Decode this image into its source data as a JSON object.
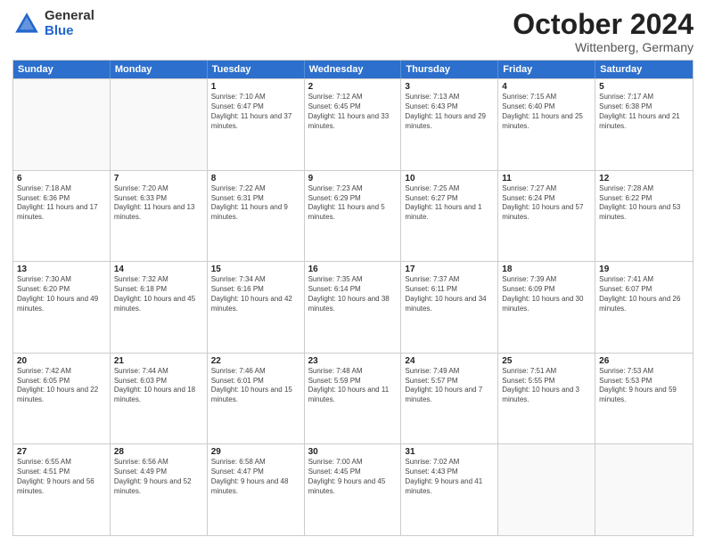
{
  "logo": {
    "general": "General",
    "blue": "Blue"
  },
  "header": {
    "month": "October 2024",
    "location": "Wittenberg, Germany"
  },
  "weekdays": [
    "Sunday",
    "Monday",
    "Tuesday",
    "Wednesday",
    "Thursday",
    "Friday",
    "Saturday"
  ],
  "weeks": [
    [
      {
        "day": "",
        "sunrise": "",
        "sunset": "",
        "daylight": ""
      },
      {
        "day": "",
        "sunrise": "",
        "sunset": "",
        "daylight": ""
      },
      {
        "day": "1",
        "sunrise": "Sunrise: 7:10 AM",
        "sunset": "Sunset: 6:47 PM",
        "daylight": "Daylight: 11 hours and 37 minutes."
      },
      {
        "day": "2",
        "sunrise": "Sunrise: 7:12 AM",
        "sunset": "Sunset: 6:45 PM",
        "daylight": "Daylight: 11 hours and 33 minutes."
      },
      {
        "day": "3",
        "sunrise": "Sunrise: 7:13 AM",
        "sunset": "Sunset: 6:43 PM",
        "daylight": "Daylight: 11 hours and 29 minutes."
      },
      {
        "day": "4",
        "sunrise": "Sunrise: 7:15 AM",
        "sunset": "Sunset: 6:40 PM",
        "daylight": "Daylight: 11 hours and 25 minutes."
      },
      {
        "day": "5",
        "sunrise": "Sunrise: 7:17 AM",
        "sunset": "Sunset: 6:38 PM",
        "daylight": "Daylight: 11 hours and 21 minutes."
      }
    ],
    [
      {
        "day": "6",
        "sunrise": "Sunrise: 7:18 AM",
        "sunset": "Sunset: 6:36 PM",
        "daylight": "Daylight: 11 hours and 17 minutes."
      },
      {
        "day": "7",
        "sunrise": "Sunrise: 7:20 AM",
        "sunset": "Sunset: 6:33 PM",
        "daylight": "Daylight: 11 hours and 13 minutes."
      },
      {
        "day": "8",
        "sunrise": "Sunrise: 7:22 AM",
        "sunset": "Sunset: 6:31 PM",
        "daylight": "Daylight: 11 hours and 9 minutes."
      },
      {
        "day": "9",
        "sunrise": "Sunrise: 7:23 AM",
        "sunset": "Sunset: 6:29 PM",
        "daylight": "Daylight: 11 hours and 5 minutes."
      },
      {
        "day": "10",
        "sunrise": "Sunrise: 7:25 AM",
        "sunset": "Sunset: 6:27 PM",
        "daylight": "Daylight: 11 hours and 1 minute."
      },
      {
        "day": "11",
        "sunrise": "Sunrise: 7:27 AM",
        "sunset": "Sunset: 6:24 PM",
        "daylight": "Daylight: 10 hours and 57 minutes."
      },
      {
        "day": "12",
        "sunrise": "Sunrise: 7:28 AM",
        "sunset": "Sunset: 6:22 PM",
        "daylight": "Daylight: 10 hours and 53 minutes."
      }
    ],
    [
      {
        "day": "13",
        "sunrise": "Sunrise: 7:30 AM",
        "sunset": "Sunset: 6:20 PM",
        "daylight": "Daylight: 10 hours and 49 minutes."
      },
      {
        "day": "14",
        "sunrise": "Sunrise: 7:32 AM",
        "sunset": "Sunset: 6:18 PM",
        "daylight": "Daylight: 10 hours and 45 minutes."
      },
      {
        "day": "15",
        "sunrise": "Sunrise: 7:34 AM",
        "sunset": "Sunset: 6:16 PM",
        "daylight": "Daylight: 10 hours and 42 minutes."
      },
      {
        "day": "16",
        "sunrise": "Sunrise: 7:35 AM",
        "sunset": "Sunset: 6:14 PM",
        "daylight": "Daylight: 10 hours and 38 minutes."
      },
      {
        "day": "17",
        "sunrise": "Sunrise: 7:37 AM",
        "sunset": "Sunset: 6:11 PM",
        "daylight": "Daylight: 10 hours and 34 minutes."
      },
      {
        "day": "18",
        "sunrise": "Sunrise: 7:39 AM",
        "sunset": "Sunset: 6:09 PM",
        "daylight": "Daylight: 10 hours and 30 minutes."
      },
      {
        "day": "19",
        "sunrise": "Sunrise: 7:41 AM",
        "sunset": "Sunset: 6:07 PM",
        "daylight": "Daylight: 10 hours and 26 minutes."
      }
    ],
    [
      {
        "day": "20",
        "sunrise": "Sunrise: 7:42 AM",
        "sunset": "Sunset: 6:05 PM",
        "daylight": "Daylight: 10 hours and 22 minutes."
      },
      {
        "day": "21",
        "sunrise": "Sunrise: 7:44 AM",
        "sunset": "Sunset: 6:03 PM",
        "daylight": "Daylight: 10 hours and 18 minutes."
      },
      {
        "day": "22",
        "sunrise": "Sunrise: 7:46 AM",
        "sunset": "Sunset: 6:01 PM",
        "daylight": "Daylight: 10 hours and 15 minutes."
      },
      {
        "day": "23",
        "sunrise": "Sunrise: 7:48 AM",
        "sunset": "Sunset: 5:59 PM",
        "daylight": "Daylight: 10 hours and 11 minutes."
      },
      {
        "day": "24",
        "sunrise": "Sunrise: 7:49 AM",
        "sunset": "Sunset: 5:57 PM",
        "daylight": "Daylight: 10 hours and 7 minutes."
      },
      {
        "day": "25",
        "sunrise": "Sunrise: 7:51 AM",
        "sunset": "Sunset: 5:55 PM",
        "daylight": "Daylight: 10 hours and 3 minutes."
      },
      {
        "day": "26",
        "sunrise": "Sunrise: 7:53 AM",
        "sunset": "Sunset: 5:53 PM",
        "daylight": "Daylight: 9 hours and 59 minutes."
      }
    ],
    [
      {
        "day": "27",
        "sunrise": "Sunrise: 6:55 AM",
        "sunset": "Sunset: 4:51 PM",
        "daylight": "Daylight: 9 hours and 56 minutes."
      },
      {
        "day": "28",
        "sunrise": "Sunrise: 6:56 AM",
        "sunset": "Sunset: 4:49 PM",
        "daylight": "Daylight: 9 hours and 52 minutes."
      },
      {
        "day": "29",
        "sunrise": "Sunrise: 6:58 AM",
        "sunset": "Sunset: 4:47 PM",
        "daylight": "Daylight: 9 hours and 48 minutes."
      },
      {
        "day": "30",
        "sunrise": "Sunrise: 7:00 AM",
        "sunset": "Sunset: 4:45 PM",
        "daylight": "Daylight: 9 hours and 45 minutes."
      },
      {
        "day": "31",
        "sunrise": "Sunrise: 7:02 AM",
        "sunset": "Sunset: 4:43 PM",
        "daylight": "Daylight: 9 hours and 41 minutes."
      },
      {
        "day": "",
        "sunrise": "",
        "sunset": "",
        "daylight": ""
      },
      {
        "day": "",
        "sunrise": "",
        "sunset": "",
        "daylight": ""
      }
    ]
  ]
}
